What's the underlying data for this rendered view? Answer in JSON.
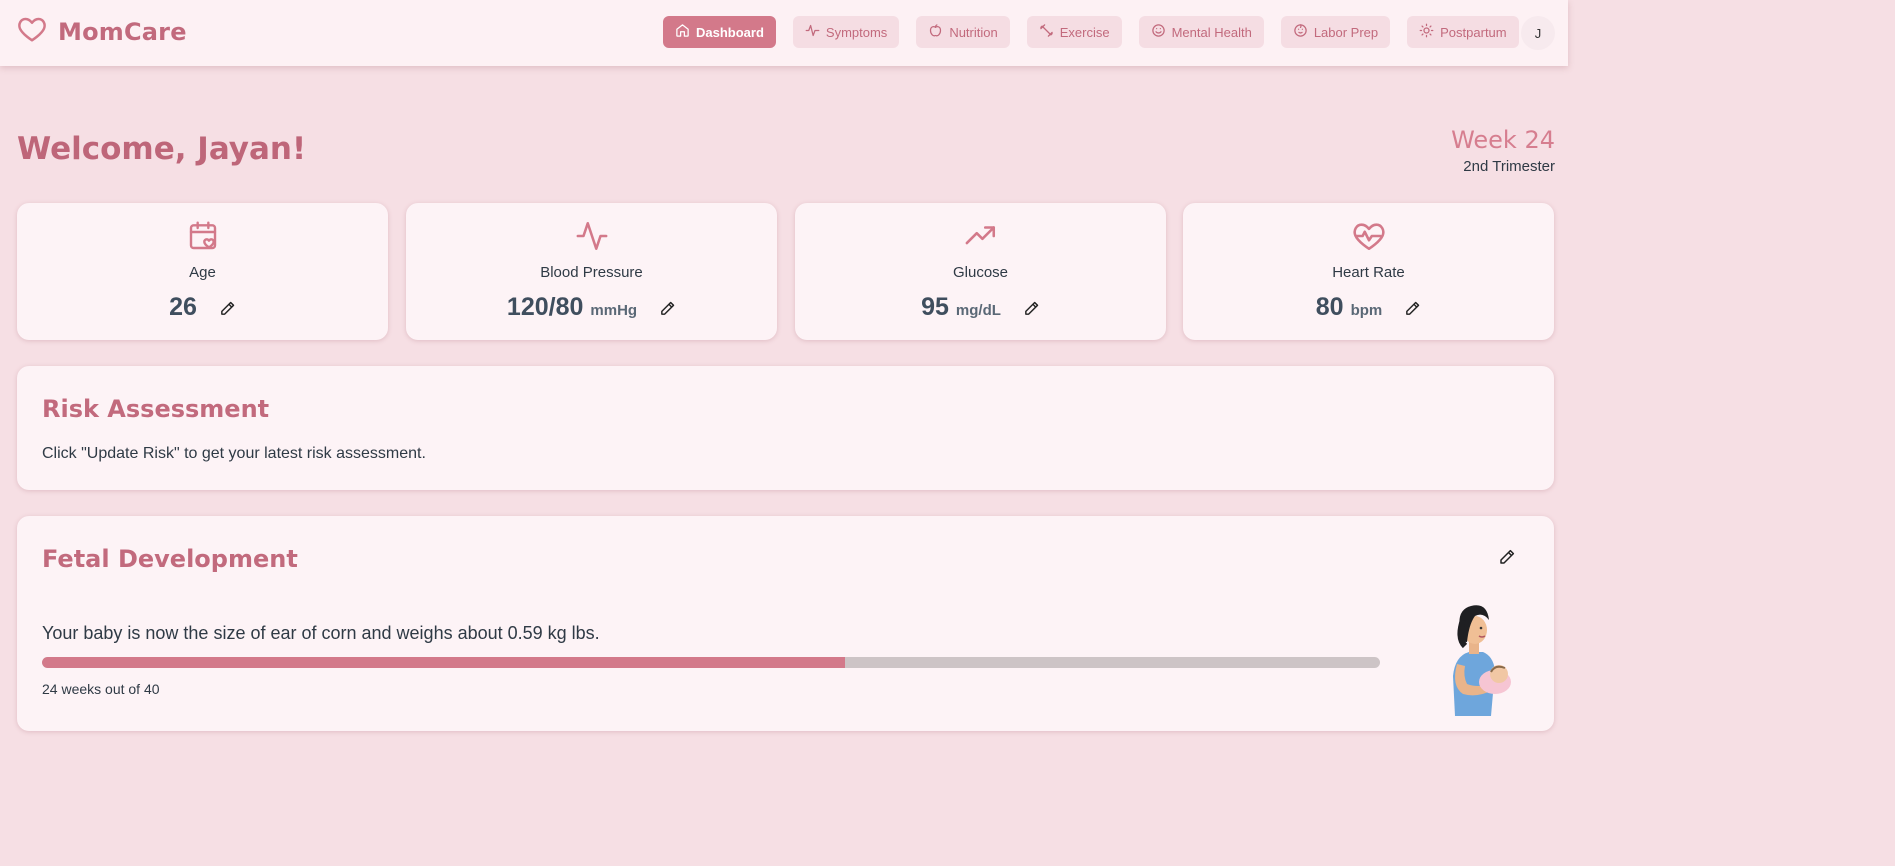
{
  "app": {
    "name": "MomCare"
  },
  "nav": {
    "items": [
      {
        "label": "Dashboard",
        "icon": "home-icon",
        "active": true
      },
      {
        "label": "Symptoms",
        "icon": "activity-icon",
        "active": false
      },
      {
        "label": "Nutrition",
        "icon": "apple-icon",
        "active": false
      },
      {
        "label": "Exercise",
        "icon": "dumbbell-icon",
        "active": false
      },
      {
        "label": "Mental Health",
        "icon": "smile-icon",
        "active": false
      },
      {
        "label": "Labor Prep",
        "icon": "baby-icon",
        "active": false
      },
      {
        "label": "Postpartum",
        "icon": "sun-icon",
        "active": false
      }
    ],
    "avatar_initial": "J"
  },
  "welcome": {
    "greeting": "Welcome, Jayan!"
  },
  "pregnancy": {
    "week": "Week 24",
    "trimester": "2nd Trimester"
  },
  "stats": [
    {
      "label": "Age",
      "value": "26",
      "unit": "",
      "icon": "calendar-heart-icon"
    },
    {
      "label": "Blood Pressure",
      "value": "120/80",
      "unit": "mmHg",
      "icon": "pulse-icon"
    },
    {
      "label": "Glucose",
      "value": "95",
      "unit": "mg/dL",
      "icon": "trending-up-icon"
    },
    {
      "label": "Heart Rate",
      "value": "80",
      "unit": "bpm",
      "icon": "heart-pulse-icon"
    }
  ],
  "risk": {
    "title": "Risk Assessment",
    "message": "Click \"Update Risk\" to get your latest risk assessment."
  },
  "fetal": {
    "title": "Fetal Development",
    "description": "Your baby is now the size of ear of corn and weighs about 0.59 kg lbs.",
    "progress_caption": "24 weeks out of 40",
    "progress_fraction": 0.6
  },
  "colors": {
    "accent": "#d3798a",
    "brand": "#c26a7d",
    "background": "#f6dfe4",
    "card": "#fdf3f6"
  }
}
